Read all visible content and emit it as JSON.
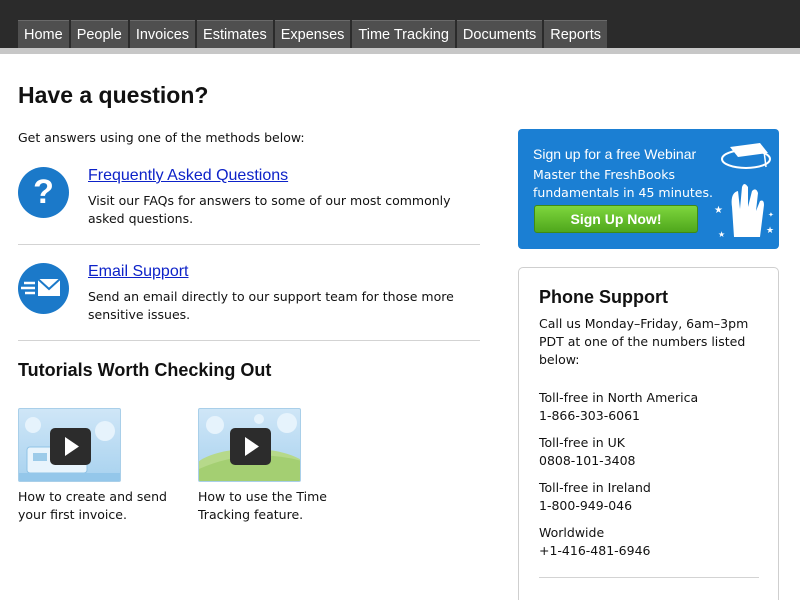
{
  "nav": {
    "tabs": [
      {
        "label": "Home"
      },
      {
        "label": "People"
      },
      {
        "label": "Invoices"
      },
      {
        "label": "Estimates"
      },
      {
        "label": "Expenses"
      },
      {
        "label": "Time Tracking"
      },
      {
        "label": "Documents"
      },
      {
        "label": "Reports"
      }
    ]
  },
  "main": {
    "title": "Have a question?",
    "intro": "Get answers using one of the methods below:",
    "methods": [
      {
        "icon": "question-icon",
        "link": "Frequently Asked Questions",
        "description": "Visit our FAQs for answers to some of our most commonly asked questions."
      },
      {
        "icon": "email-icon",
        "link": "Email Support",
        "description": "Send an email directly to our support team for those more sensitive issues."
      }
    ],
    "tutorials_title": "Tutorials Worth Checking Out",
    "tutorials": [
      {
        "caption": "How to create and send your first invoice.",
        "icon": "play-icon"
      },
      {
        "caption": "How to use the Time Tracking feature.",
        "icon": "play-icon"
      }
    ]
  },
  "webinar": {
    "headline": "Sign up for a free Webinar",
    "subtext": "Master the FreshBooks fundamentals in 45 minutes.",
    "button": "Sign Up Now!",
    "icon": "graduate-hand-icon"
  },
  "phone_support": {
    "title": "Phone Support",
    "intro": "Call us Monday–Friday, 6am–3pm PDT at one of the numbers listed below:",
    "entries": [
      {
        "label": "Toll-free in North America",
        "number": "1-866-303-6061"
      },
      {
        "label": "Toll-free in UK",
        "number": "0808-101-3408"
      },
      {
        "label": "Toll-free in Ireland",
        "number": "1-800-949-046"
      },
      {
        "label": "Worldwide",
        "number": "+1-416-481-6946"
      }
    ]
  },
  "colors": {
    "nav_bg": "#2b2b2b",
    "tab_bg": "#4f4f4f",
    "link": "#0d22c8",
    "accent_blue": "#1b79c9",
    "webinar_bg": "#1b7fd3",
    "button_green": "#5fb82a"
  }
}
